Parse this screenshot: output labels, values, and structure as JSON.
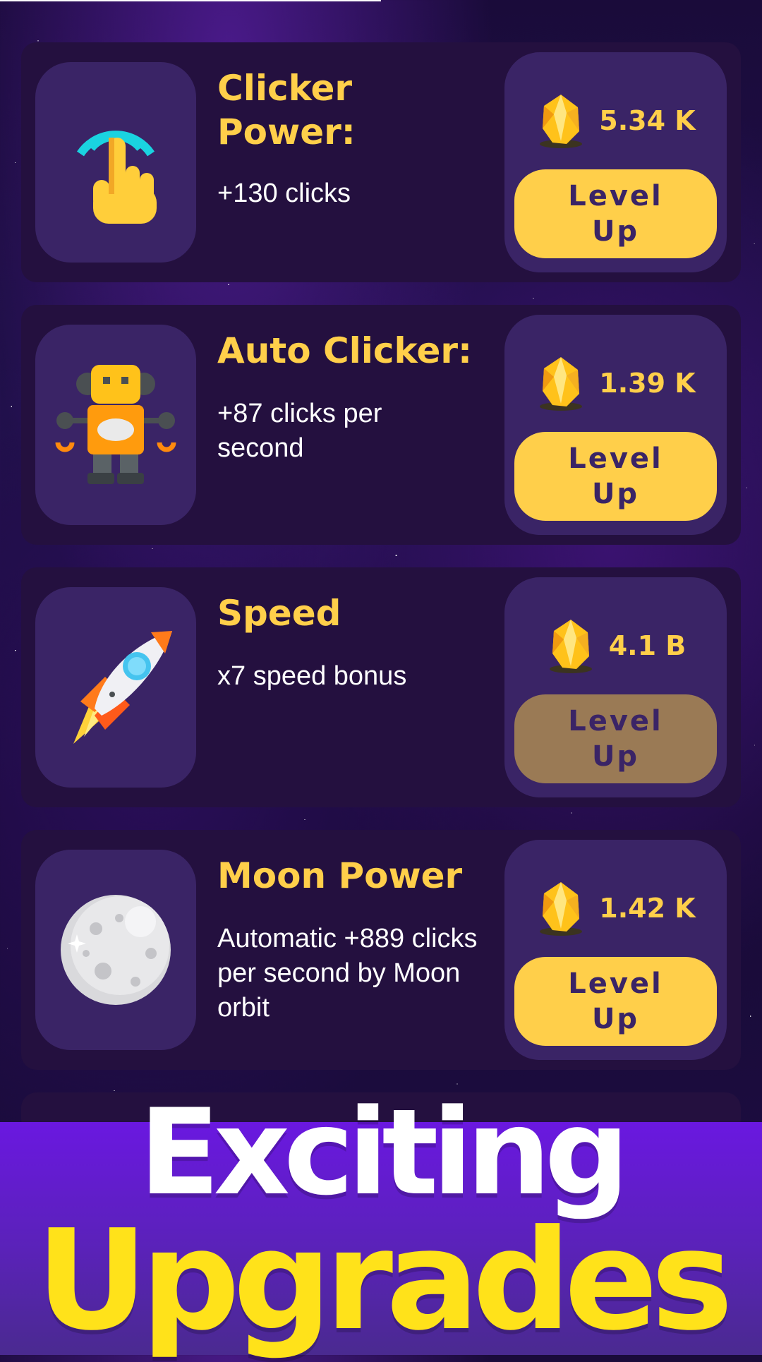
{
  "upgrades": [
    {
      "title": "Clicker Power:",
      "description": "+130 clicks",
      "icon": "tap-hand-icon",
      "price": "5.34 K",
      "button_label": "Level\nUp",
      "enabled": true
    },
    {
      "title": "Auto Clicker:",
      "description": "+87 clicks per second",
      "icon": "robot-icon",
      "price": "1.39 K",
      "button_label": "Level\nUp",
      "enabled": true
    },
    {
      "title": "Speed",
      "description": "x7 speed bonus",
      "icon": "rocket-icon",
      "price": "4.1 B",
      "button_label": "Level\nUp",
      "enabled": false
    },
    {
      "title": "Moon Power",
      "description": "Automatic +889 clicks per second by Moon orbit",
      "icon": "moon-icon",
      "price": "1.42 K",
      "button_label": "Level\nUp",
      "enabled": true
    }
  ],
  "banner": {
    "line1": "Exciting",
    "line2": "Upgrades"
  },
  "colors": {
    "accent": "#ffcf4a",
    "card_bg": "#24103f",
    "panel_bg": "#3a2466",
    "disabled_button": "#9a7a55",
    "banner_yellow": "#ffe21a"
  },
  "currency_icon": "crystal-gem-icon"
}
